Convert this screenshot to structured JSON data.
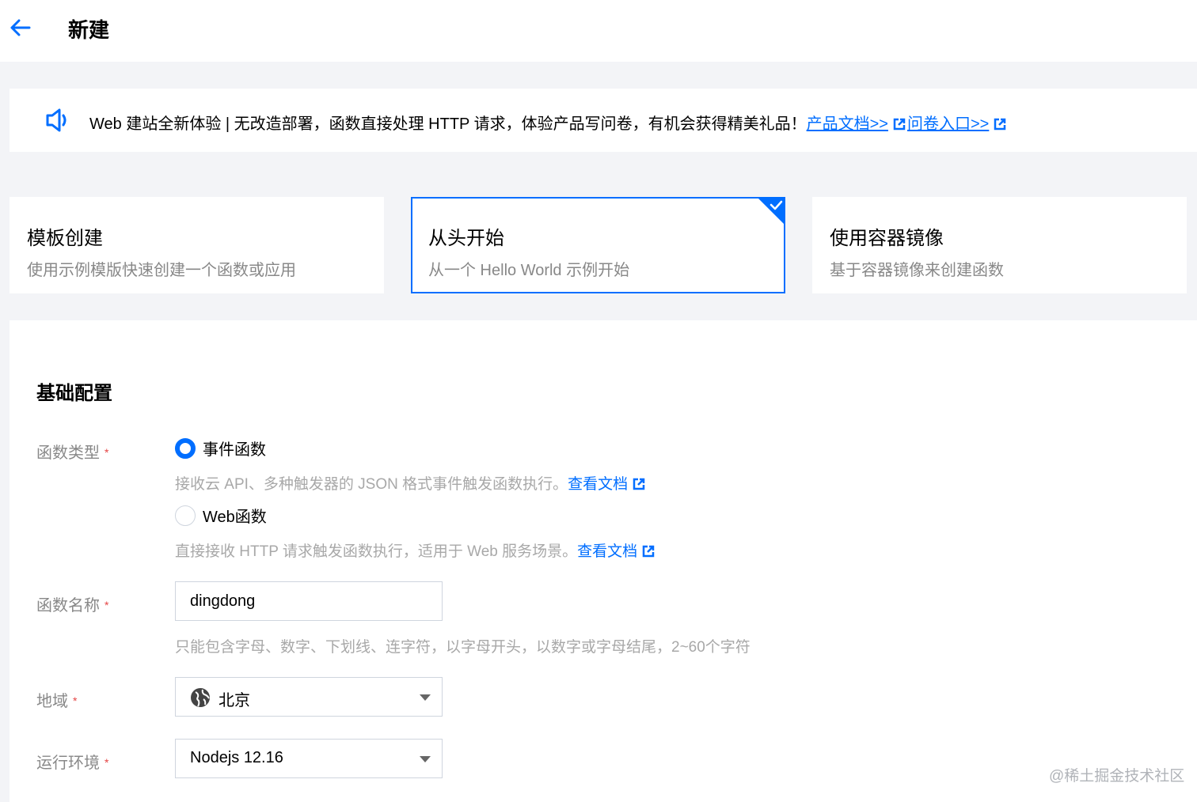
{
  "header": {
    "title": "新建"
  },
  "notice": {
    "text": "Web 建站全新体验 | 无改造部署，函数直接处理 HTTP 请求，体验产品写问卷，有机会获得精美礼品！",
    "link_docs": "产品文档>>",
    "link_survey": "问卷入口>>"
  },
  "create_modes": [
    {
      "title": "模板创建",
      "desc": "使用示例模版快速创建一个函数或应用",
      "selected": false
    },
    {
      "title": "从头开始",
      "desc": "从一个 Hello World 示例开始",
      "selected": true
    },
    {
      "title": "使用容器镜像",
      "desc": "基于容器镜像来创建函数",
      "selected": false
    }
  ],
  "form": {
    "section_title": "基础配置",
    "func_type": {
      "label": "函数类型",
      "options": [
        {
          "label": "事件函数",
          "checked": true,
          "hint": "接收云 API、多种触发器的 JSON 格式事件触发函数执行。",
          "link": "查看文档"
        },
        {
          "label": "Web函数",
          "checked": false,
          "hint": "直接接收 HTTP 请求触发函数执行，适用于 Web 服务场景。",
          "link": "查看文档"
        }
      ]
    },
    "func_name": {
      "label": "函数名称",
      "value": "dingdong",
      "hint": "只能包含字母、数字、下划线、连字符，以字母开头，以数字或字母结尾，2~60个字符"
    },
    "region": {
      "label": "地域",
      "value": "北京"
    },
    "runtime": {
      "label": "运行环境",
      "value": "Nodejs 12.16"
    },
    "required_mark": "*"
  },
  "watermark": "@稀土掘金技术社区",
  "colors": {
    "accent": "#006eff",
    "required": "#e54545"
  }
}
